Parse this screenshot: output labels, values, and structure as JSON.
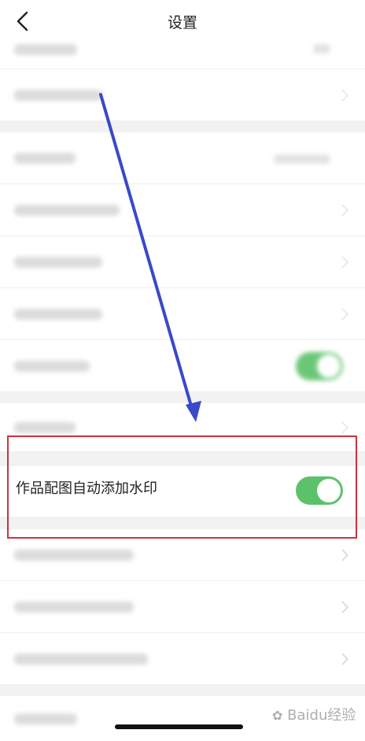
{
  "header": {
    "title": "设置",
    "back_icon": "chevron-left-icon"
  },
  "settings": {
    "watermark_toggle": {
      "label": "作品配图自动添加水印",
      "state": "on",
      "color": "#5cc26a"
    }
  },
  "annotations": {
    "arrow_color": "#3a49c9",
    "highlight_color": "#d0313e"
  },
  "watermark": {
    "text": "Baidu经验",
    "logo_icon": "baidu-paw-icon"
  }
}
